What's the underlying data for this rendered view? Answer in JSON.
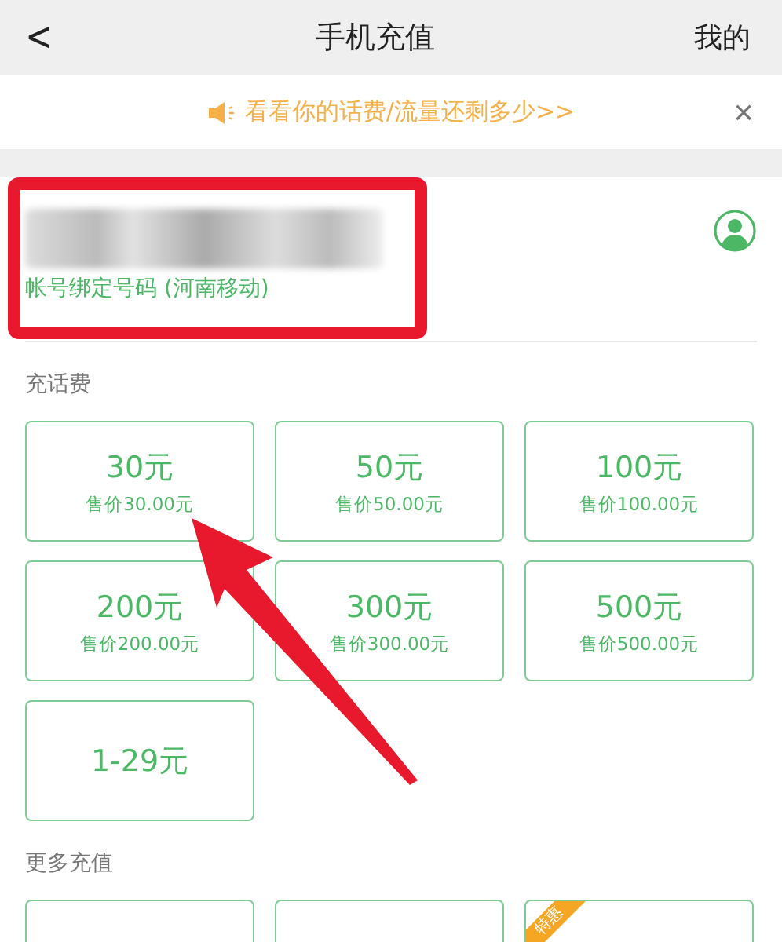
{
  "nav_bar": {
    "back": "<",
    "title": "手机充值",
    "right_link": "我的"
  },
  "notice": {
    "text": "看看你的话费/流量还剩多少>>",
    "close": "×"
  },
  "account": {
    "caption": "帐号绑定号码 (河南移动)"
  },
  "sections": [
    {
      "title": "充话费",
      "cards": [
        {
          "kind": "priced",
          "amount": "30元",
          "price": "售价30.00元"
        },
        {
          "kind": "priced",
          "amount": "50元",
          "price": "售价50.00元"
        },
        {
          "kind": "priced",
          "amount": "100元",
          "price": "售价100.00元"
        },
        {
          "kind": "priced",
          "amount": "200元",
          "price": "售价200.00元"
        },
        {
          "kind": "priced",
          "amount": "300元",
          "price": "售价300.00元"
        },
        {
          "kind": "priced",
          "amount": "500元",
          "price": "售价500.00元"
        },
        {
          "kind": "plain",
          "amount": "1-29元"
        }
      ]
    },
    {
      "title": "更多充值",
      "cards": [
        {
          "kind": "cut"
        },
        {
          "kind": "cut"
        },
        {
          "kind": "cut",
          "badge": "特惠"
        }
      ]
    }
  ]
}
